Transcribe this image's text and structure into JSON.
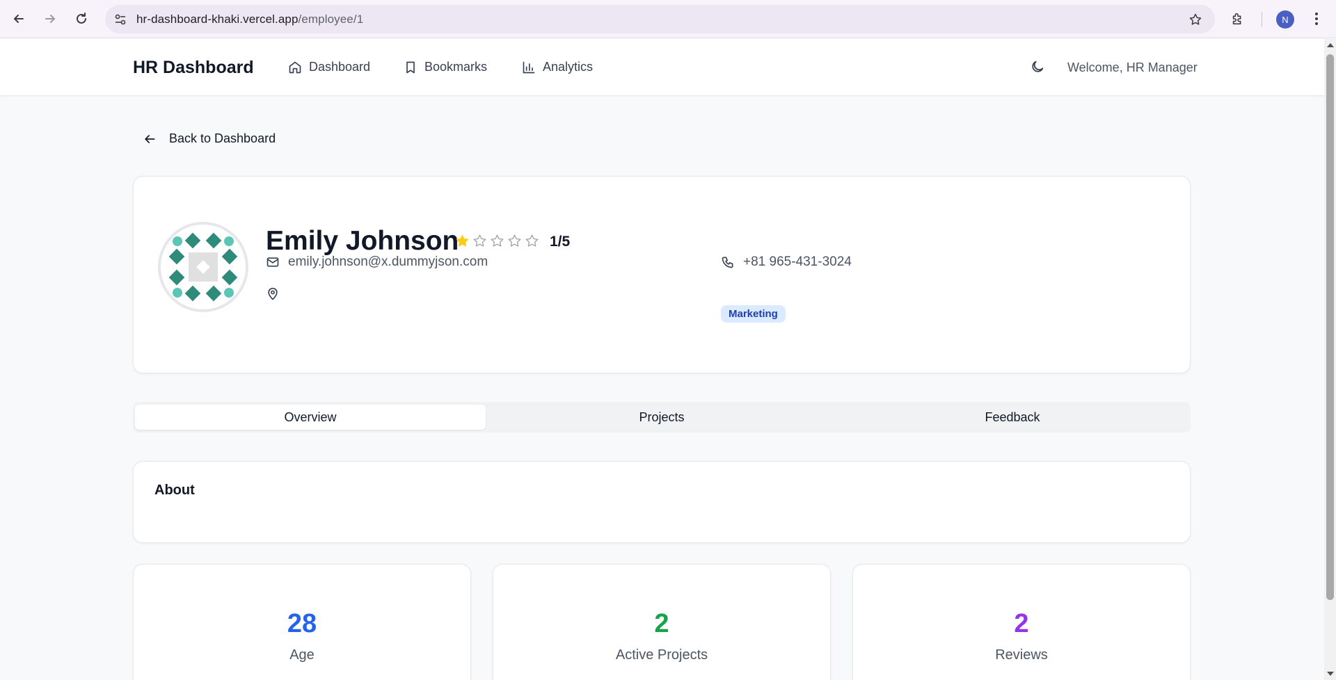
{
  "browser": {
    "url_host": "hr-dashboard-khaki.vercel.app",
    "url_path": "/employee/1",
    "profile_initial": "N"
  },
  "header": {
    "brand": "HR Dashboard",
    "nav": [
      {
        "label": "Dashboard",
        "icon": "home-icon"
      },
      {
        "label": "Bookmarks",
        "icon": "bookmark-icon"
      },
      {
        "label": "Analytics",
        "icon": "bar-chart-icon"
      }
    ],
    "theme_icon": "moon-icon",
    "welcome": "Welcome, HR Manager"
  },
  "back_link": "Back to Dashboard",
  "employee": {
    "name": "Emily Johnson",
    "rating": 1,
    "rating_max": 5,
    "rating_text": "1/5",
    "email": "emily.johnson@x.dummyjson.com",
    "phone": "+81 965-431-3024",
    "address": "",
    "department": "Marketing"
  },
  "tabs": [
    {
      "label": "Overview",
      "active": true
    },
    {
      "label": "Projects",
      "active": false
    },
    {
      "label": "Feedback",
      "active": false
    }
  ],
  "about": {
    "title": "About",
    "text": ""
  },
  "stats": [
    {
      "value": "28",
      "label": "Age",
      "color": "#2563eb"
    },
    {
      "value": "2",
      "label": "Active Projects",
      "color": "#16a34a"
    },
    {
      "value": "2",
      "label": "Reviews",
      "color": "#9333ea"
    }
  ],
  "colors": {
    "star_filled": "#facc15",
    "star_empty": "#9ca3af",
    "badge_bg": "#dbeafe",
    "badge_text": "#1e40af",
    "avatar_dark": "#2e8b7a",
    "avatar_light": "#5cc6b4"
  }
}
